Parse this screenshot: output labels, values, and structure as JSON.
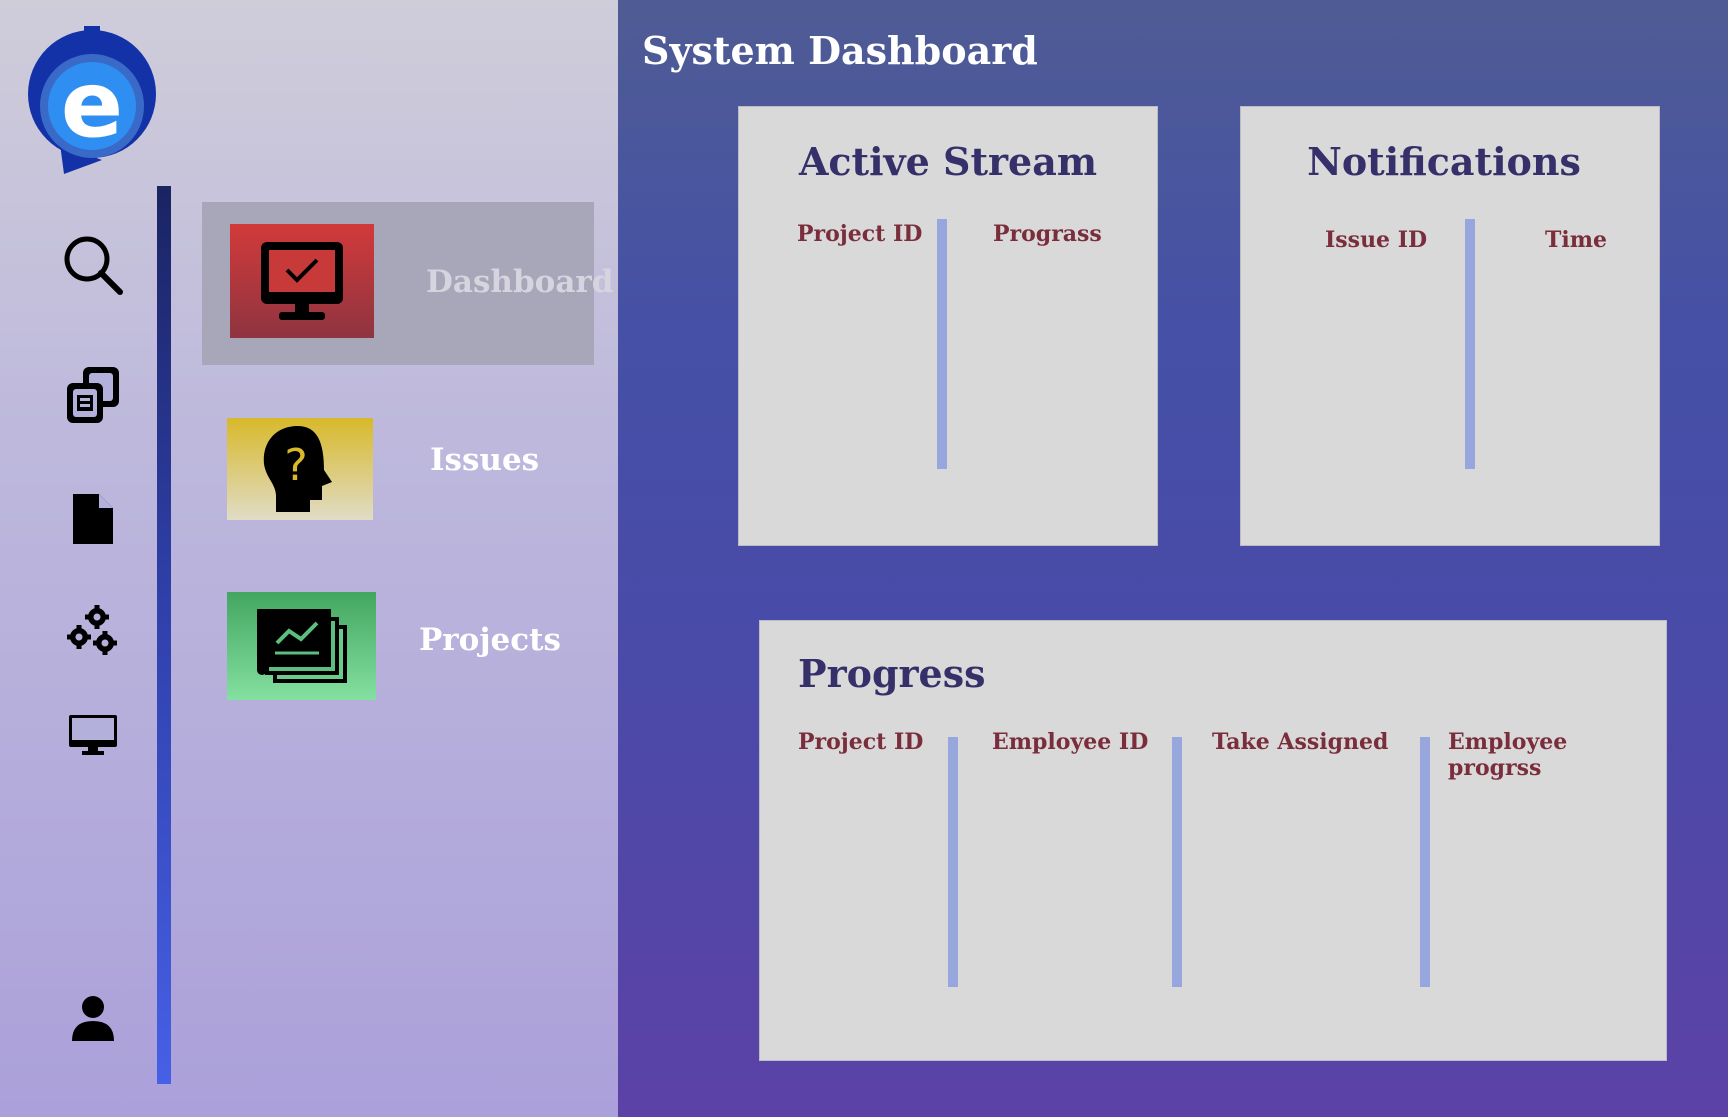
{
  "app": {
    "logo_letter": "e"
  },
  "colors": {
    "accent": "#2f6de0",
    "dashboard_thumb": "#c93838",
    "issues_thumb": "#d9b834",
    "projects_thumb": "#49b06a"
  },
  "rail_icons": [
    "search-icon",
    "copy-documents-icon",
    "file-icon",
    "gears-icon",
    "monitor-icon",
    "user-icon"
  ],
  "nav": {
    "items": [
      {
        "label": "Dashboard",
        "icon": "monitor-check-icon",
        "selected": true
      },
      {
        "label": "Issues",
        "icon": "head-question-icon",
        "selected": false
      },
      {
        "label": "Projects",
        "icon": "chart-stack-icon",
        "selected": false
      }
    ]
  },
  "main": {
    "title": "System Dashboard",
    "active_stream": {
      "title": "Active Stream",
      "columns": [
        "Project ID",
        "Prograss"
      ]
    },
    "notifications": {
      "title": "Notifications",
      "columns": [
        "Issue ID",
        "Time"
      ]
    },
    "progress": {
      "title": "Progress",
      "columns": [
        "Project ID",
        "Employee ID",
        "Take Assigned",
        "Employee progrss"
      ]
    }
  }
}
